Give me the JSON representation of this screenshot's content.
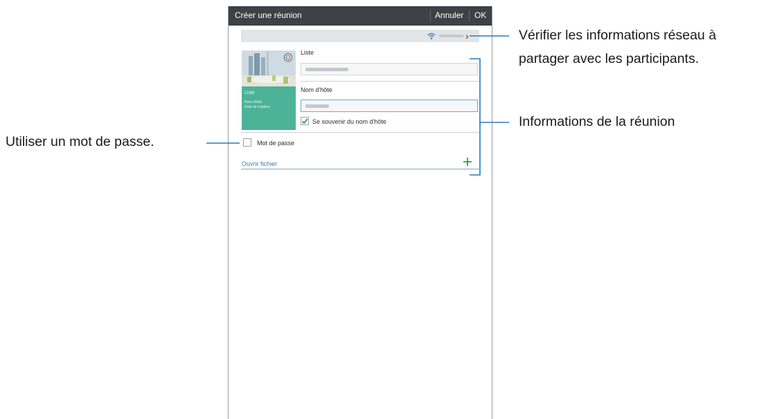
{
  "app": {
    "title": "Créer une réunion",
    "cancel_label": "Annuler",
    "ok_label": "OK"
  },
  "network": {
    "icon": "wifi-icon"
  },
  "cover": {
    "list_label": "Liste",
    "host_label": "Nom d'hôte",
    "date_label": "Date de création",
    "settings_icon": "gear-icon"
  },
  "form": {
    "list_label": "Liste",
    "host_label": "Nom d'hôte",
    "remember_host_label": "Se souvenir du nom d'hôte",
    "remember_host_checked": true,
    "password_label": "Mot de passe",
    "password_checked": false,
    "open_file_label": "Ouvrir fichier",
    "add_icon": "plus-icon"
  },
  "annotations": {
    "network_line1": "Vérifier les informations réseau à",
    "network_line2": "partager avec les participants.",
    "meeting_info": "Informations de la réunion",
    "password": "Utiliser un mot de passe."
  },
  "colors": {
    "titlebar": "#3e4046",
    "accent_green": "#4db398",
    "link_blue": "#3b7fb0",
    "callout_line": "#2a7ab5"
  }
}
